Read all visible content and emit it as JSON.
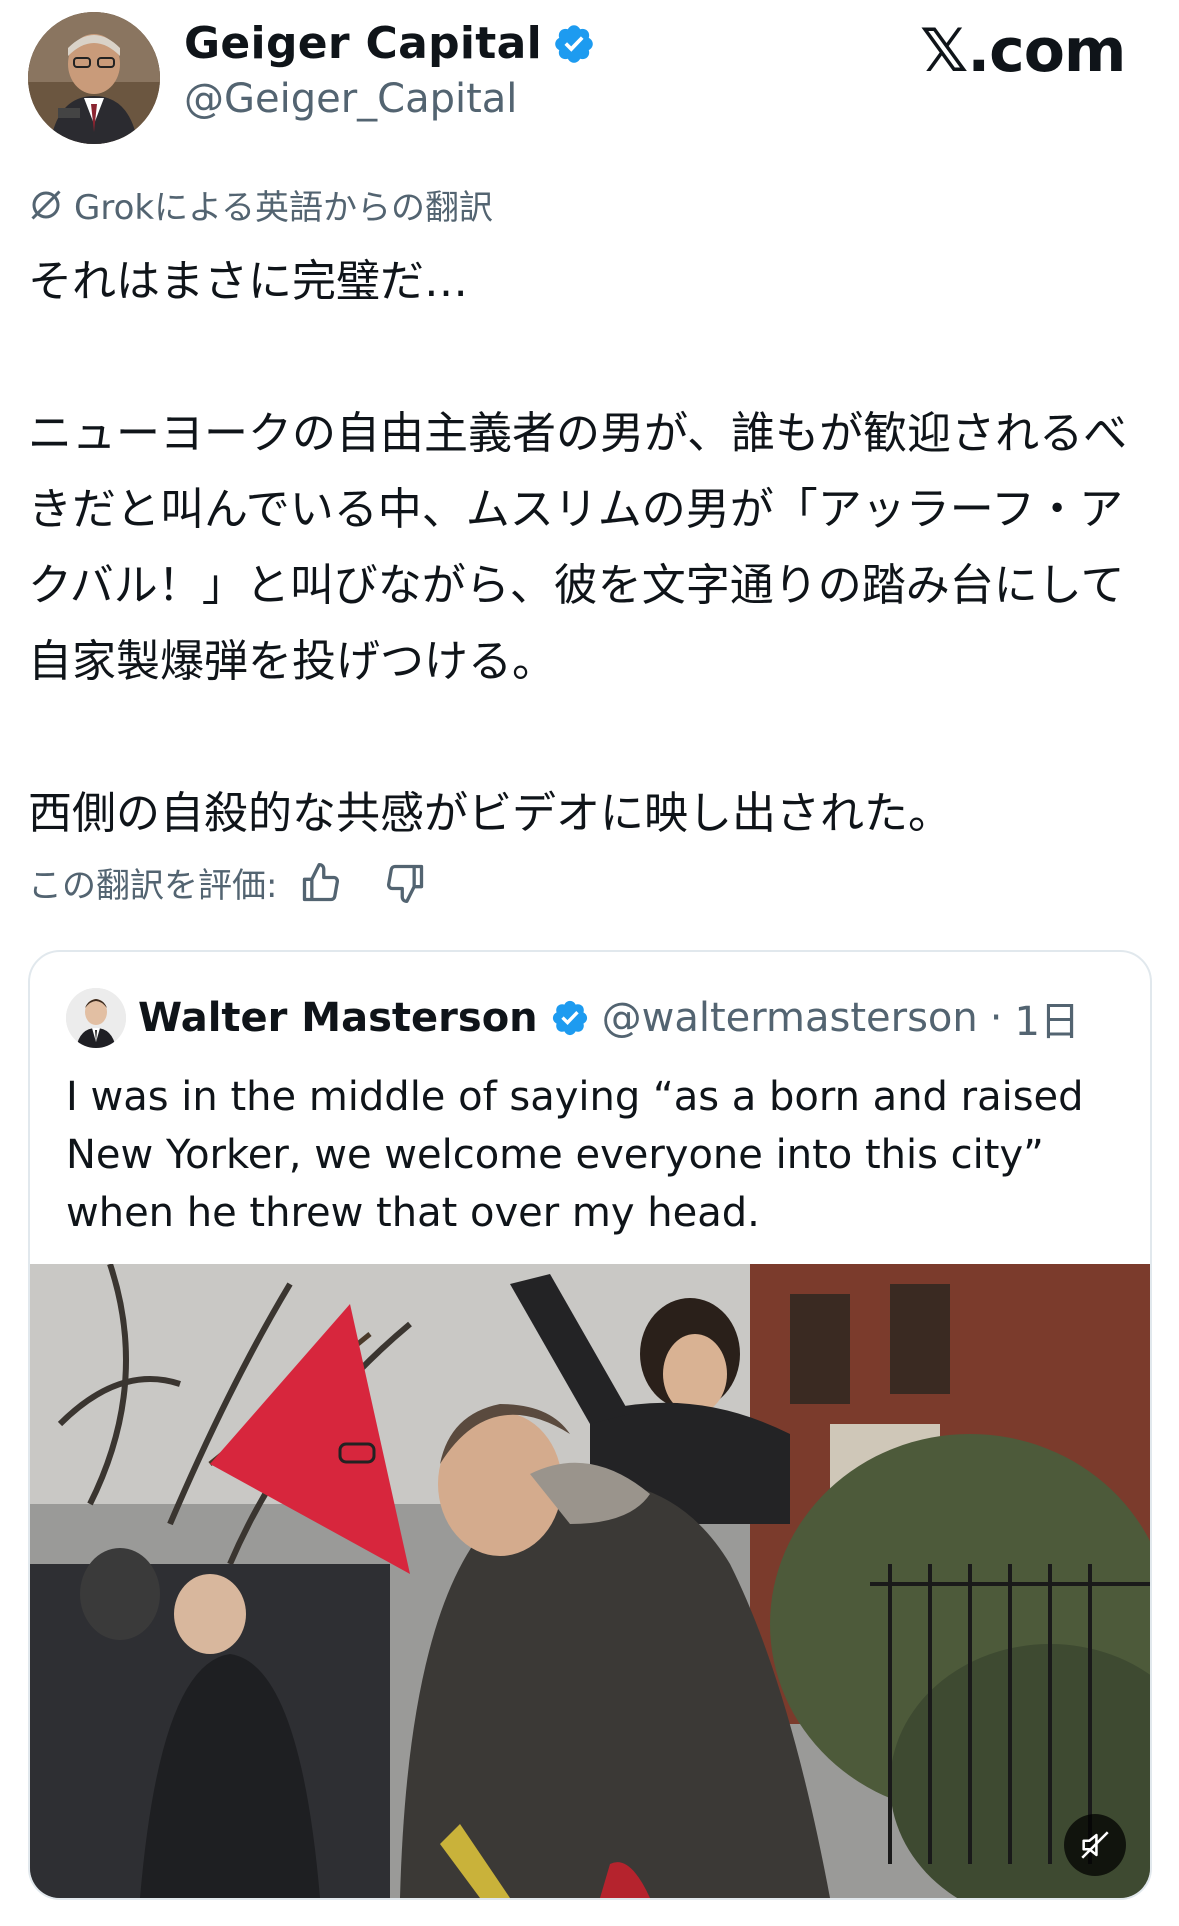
{
  "post": {
    "display_name": "Geiger Capital",
    "handle": "@Geiger_Capital",
    "site_label": "𝕏.com",
    "translation_label": "Grokによる英語からの翻訳",
    "text": "それはまさに完璧だ…\n\nニューヨークの自由主義者の男が、誰もが歓迎されるべきだと叫んでいる中、ムスリムの男が「アッラーフ・アクバル！」と叫びながら、彼を文字通りの踏み台にして自家製爆弾を投げつける。\n\n西側の自殺的な共感がビデオに映し出された。",
    "rate_label": "この翻訳を評価:",
    "icons": {
      "verified": "verified-badge-icon",
      "grok": "grok-icon",
      "like": "thumbs-up-icon",
      "dislike": "thumbs-down-icon"
    }
  },
  "quoted": {
    "display_name": "Walter Masterson",
    "handle": "@waltermasterson",
    "separator": "·",
    "time": "1日",
    "text": "I was in the middle of saying “as a born and raised New Yorker, we welcome everyone into this city” when he threw that over my head.",
    "media_icon": "muted-speaker-icon"
  },
  "colors": {
    "verified": "#1d9bf0",
    "secondary_text": "#536471",
    "border": "#e1e8ed",
    "flag": "#d7263d"
  }
}
